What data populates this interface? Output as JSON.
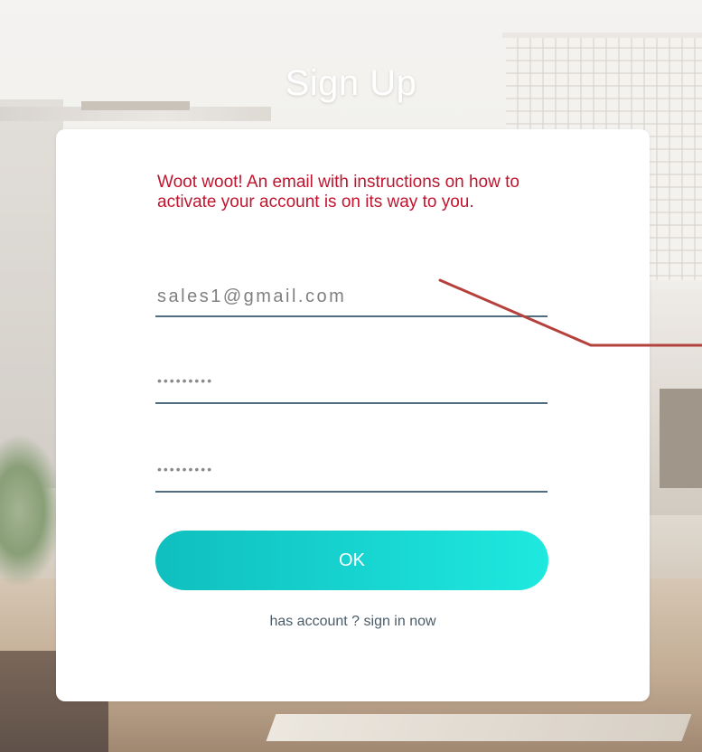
{
  "page": {
    "title": "Sign Up"
  },
  "signup_form": {
    "message": "Woot woot! An email with instructions on how to activate your account is on its way to you.",
    "email_value": "sales1@gmail.com",
    "password_mask": "•••••••••",
    "confirm_password_mask": "•••••••••",
    "ok_label": "OK",
    "signin_link": "has account ? sign in now"
  },
  "colors": {
    "message": "#c0152f",
    "button_gradient_start": "#0fbfbf",
    "button_gradient_end": "#1ee9df",
    "field_underline": "#4f6e82",
    "annotation_arrow": "#b5413c"
  },
  "icons": {
    "annotation": "annotation-arrow"
  }
}
